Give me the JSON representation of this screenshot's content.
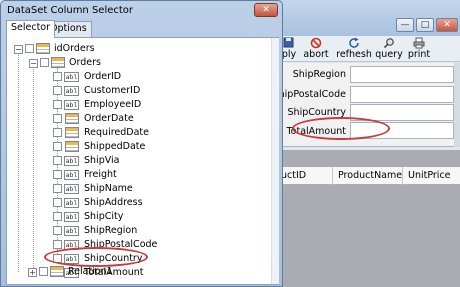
{
  "dialog": {
    "title": "DataSet Column Selector",
    "close_glyph": "✕",
    "tabs": [
      {
        "label": "Selector",
        "active": true
      },
      {
        "label": "Options",
        "active": false
      }
    ],
    "tree": {
      "root": {
        "label": "idOrders",
        "expanded": true
      },
      "table": {
        "label": "Orders",
        "expanded": true
      },
      "columns": [
        {
          "label": "OrderID",
          "icon": "abl",
          "checked": false
        },
        {
          "label": "CustomerID",
          "icon": "abl",
          "checked": false
        },
        {
          "label": "EmployeeID",
          "icon": "abl",
          "checked": false
        },
        {
          "label": "OrderDate",
          "icon": "abl",
          "checked": false
        },
        {
          "label": "RequiredDate",
          "icon": "abl",
          "checked": false
        },
        {
          "label": "ShippedDate",
          "icon": "abl",
          "checked": false
        },
        {
          "label": "ShipVia",
          "icon": "abl",
          "checked": false
        },
        {
          "label": "Freight",
          "icon": "abl",
          "checked": false
        },
        {
          "label": "ShipName",
          "icon": "abl",
          "checked": false
        },
        {
          "label": "ShipAddress",
          "icon": "abl",
          "checked": false
        },
        {
          "label": "ShipCity",
          "icon": "abl",
          "checked": false
        },
        {
          "label": "ShipRegion",
          "icon": "abl",
          "checked": false
        },
        {
          "label": "ShipPostalCode",
          "icon": "abl",
          "checked": false
        },
        {
          "label": "ShipCountry",
          "icon": "abl",
          "checked": false
        },
        {
          "label": "TotalAmount",
          "icon": "abl",
          "checked": true
        }
      ],
      "relation": {
        "label": "Relation1",
        "expanded": false
      }
    }
  },
  "app": {
    "window_buttons": {
      "minimize": "—",
      "maximize": "□",
      "close": "✕"
    },
    "toolbar": [
      {
        "label": "ply",
        "icon": "apply-icon",
        "glyph": ""
      },
      {
        "label": "abort",
        "icon": "abort-icon",
        "glyph": "⊘"
      },
      {
        "label": "refhesh",
        "icon": "refresh-icon",
        "glyph": "⟳"
      },
      {
        "label": "query",
        "icon": "query-icon",
        "glyph": "⚲"
      },
      {
        "label": "print",
        "icon": "print-icon",
        "glyph": "⎙"
      }
    ],
    "form_fields": [
      {
        "label": "ShipRegion",
        "value": ""
      },
      {
        "label": "ShipPostalCode",
        "value": ""
      },
      {
        "label": "ShipCountry",
        "value": ""
      },
      {
        "label": "TotalAmount",
        "value": ""
      }
    ],
    "grid_columns": [
      "uctID",
      "ProductName",
      "UnitPrice"
    ]
  },
  "colors": {
    "highlight_ellipse": "#c93a3a",
    "dialog_frame": "#a6bfdc",
    "grid_background": "#a9acb0"
  }
}
